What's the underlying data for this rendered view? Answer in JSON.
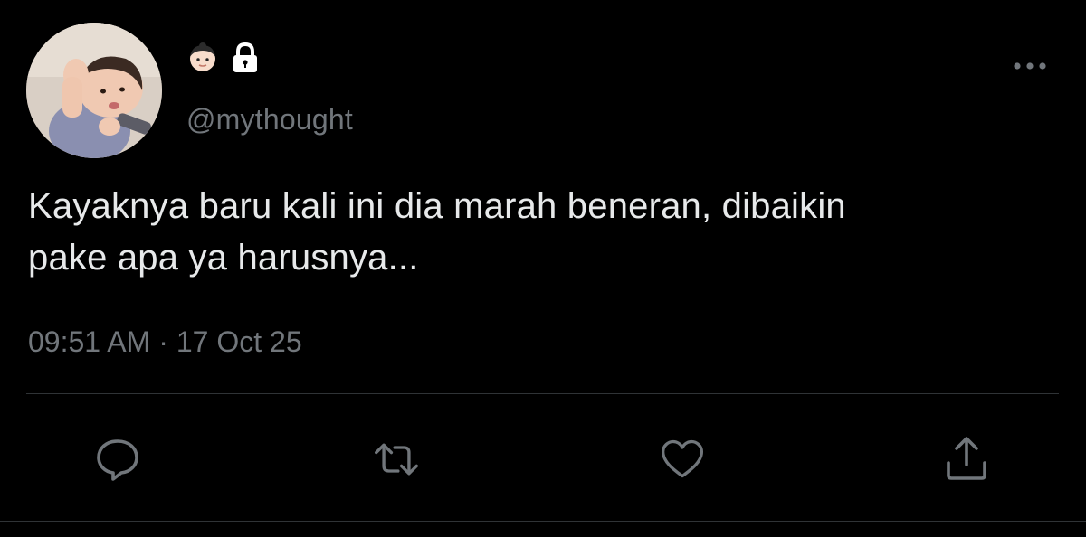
{
  "user": {
    "avatar_icon": "baby-photo-avatar",
    "name_emoji": "girl-face-emoji",
    "protected_icon": "lock-icon",
    "handle": "@mythought"
  },
  "tweet": {
    "text_line_1": "Kayaknya baru kali ini dia marah beneran, dibaikin",
    "text_line_2": "pake apa ya harusnya...",
    "time": "09:51 AM",
    "separator": "·",
    "date": "17 Oct 25"
  },
  "actions": {
    "reply_icon": "reply-icon",
    "retweet_icon": "retweet-icon",
    "like_icon": "heart-icon",
    "share_icon": "share-icon",
    "more_icon": "more-options-icon"
  },
  "colors": {
    "background": "#000000",
    "text_primary": "#e7e9ea",
    "text_secondary": "#71767b",
    "icon": "#71767b",
    "divider": "#2f3336"
  }
}
